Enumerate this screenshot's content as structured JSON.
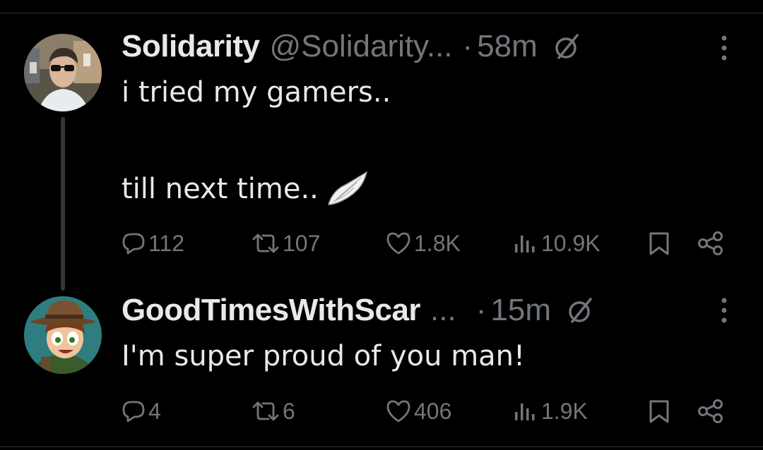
{
  "colors": {
    "background": "#000000",
    "primary_text": "#e7e9ea",
    "secondary_text": "#71767b",
    "thread_line": "#333639",
    "divider": "#2f3336"
  },
  "tweets": [
    {
      "display_name": "Solidarity",
      "handle": "@Solidarity...",
      "separator": "·",
      "time": "58m",
      "text_line1": "i tried my gamers..",
      "text_line2": "till next time..",
      "emoji": "wing-icon",
      "replies": "112",
      "retweets": "107",
      "likes": "1.8K",
      "views": "10.9K",
      "icons": [
        "reply-icon",
        "retweet-icon",
        "like-icon",
        "views-icon",
        "bookmark-icon",
        "share-icon",
        "grok-icon",
        "more-icon"
      ]
    },
    {
      "display_name": "GoodTimesWithScar",
      "handle": "...",
      "separator": "·",
      "time": "15m",
      "text_line1": "I'm super proud of you man!",
      "replies": "4",
      "retweets": "6",
      "likes": "406",
      "views": "1.9K",
      "icons": [
        "reply-icon",
        "retweet-icon",
        "like-icon",
        "views-icon",
        "bookmark-icon",
        "share-icon",
        "grok-icon",
        "more-icon"
      ]
    }
  ]
}
